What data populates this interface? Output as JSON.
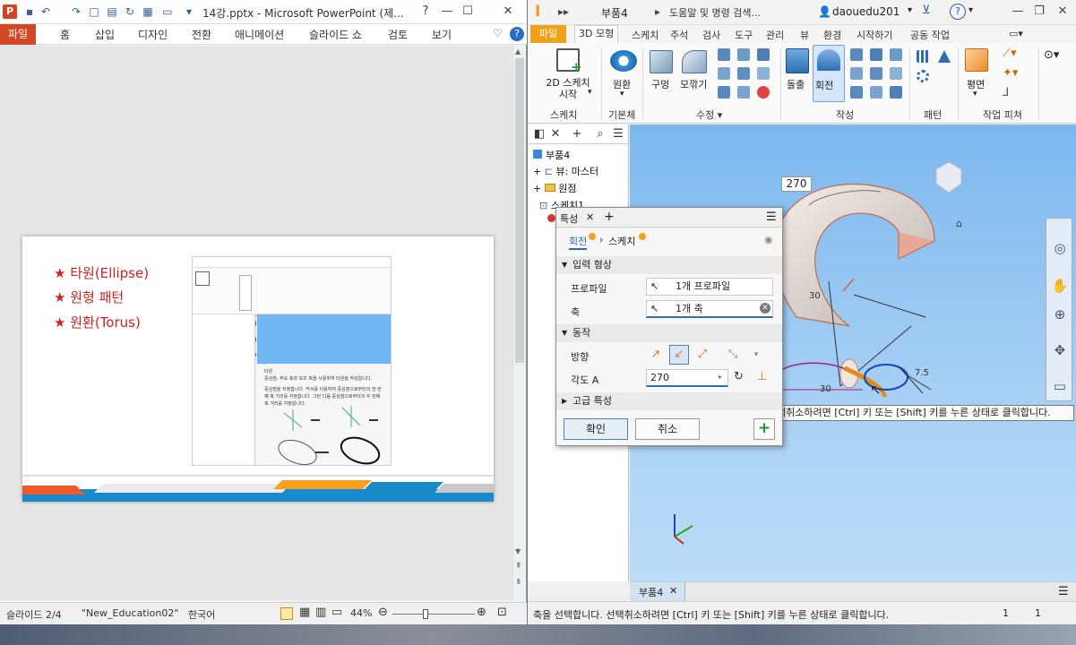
{
  "powerpoint": {
    "title": "14강.pptx - Microsoft PowerPoint (제...",
    "logo_letter": "P",
    "ribbon_tabs": [
      "파일",
      "홈",
      "삽입",
      "디자인",
      "전환",
      "애니메이션",
      "슬라이드 쇼",
      "검토",
      "보기"
    ],
    "slide": {
      "bullets": [
        "★ 타원(Ellipse)",
        "★ 원형 패턴",
        "★ 원환(Torus)"
      ],
      "mini_help_lines": [
        "타원",
        "중심점, 주요 축과 보조 축을 사용하여 타원을 작성합니다.",
        "중심점을 지정합니다. 커서를 이용하여 중심점으로부터의 한 번",
        "째 축 거리를 지정합니다. 그런 다음 중심점으로부터의 두 번째",
        "축 거리를 지정합니다."
      ]
    },
    "status": {
      "slide": "슬라이드 2/4",
      "theme": "\"New_Education02\"",
      "language": "한국어",
      "zoom": "44%",
      "zoom_fraction": 0.4
    }
  },
  "inventor": {
    "logo_letter": "I",
    "doc_title": "부품4",
    "search_placeholder": "도움말 및 명령 검색...",
    "user": "daouedu201",
    "help_icon": "?",
    "tabs": [
      "파일",
      "3D 모형",
      "스케치",
      "주석",
      "검사",
      "도구",
      "관리",
      "뷰",
      "환경",
      "시작하기",
      "공동 작업"
    ],
    "ribbon": {
      "sketch_btn": "2D 스케치\n시작",
      "sketch_group": "스케치",
      "primitive_btn": "원환",
      "primitive_group": "기본체",
      "hole_btn": "구멍",
      "fillet_btn": "모깎기",
      "modify_group": "수정 ▾",
      "extrude_btn": "돌출",
      "revolve_btn": "회전",
      "create_group": "작성",
      "pattern_group": "패턴",
      "plane_btn": "평면",
      "workfeature_group": "작업 피쳐"
    },
    "browser": {
      "tree": [
        "부품4",
        "뷰: 마스터",
        "원점",
        "스케치1"
      ]
    },
    "properties": {
      "tab_title": "특성",
      "breadcrumb_revolve": "회전",
      "breadcrumb_sketch": "스케치",
      "section_input": "입력 형상",
      "profile_label": "프로파일",
      "profile_value": "1개 프로파일",
      "axis_label": "축",
      "axis_value": "1개 축",
      "section_behavior": "동작",
      "direction_label": "방향",
      "angle_label": "각도 A",
      "angle_value": "270",
      "section_advanced": "고급 특성",
      "ok": "확인",
      "cancel": "취소"
    },
    "viewport": {
      "angle_dim": "270",
      "dim_30a": "30",
      "dim_30b": "30",
      "dim_75": "7.5",
      "tooltip": "택취소하려면 [Ctrl] 키 또는 [Shift] 키를 누른 상태로 클릭합니다."
    },
    "doc_tab": "부품4",
    "status": {
      "message": "축을 선택합니다. 선택취소하려면 [Ctrl] 키 또는 [Shift] 키를 누른 상태로 클릭합니다.",
      "count_a": "1",
      "count_b": "1"
    }
  }
}
